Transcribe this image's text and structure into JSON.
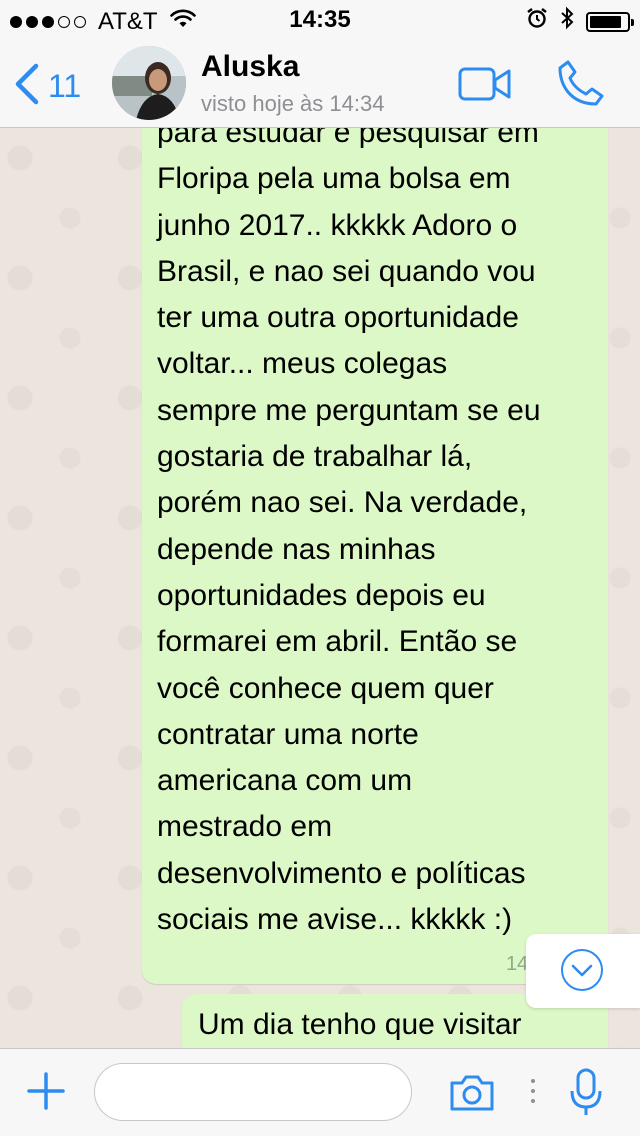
{
  "status_bar": {
    "carrier": "AT&T",
    "time": "14:35",
    "signal_bars_filled": 3,
    "signal_bars_total": 5,
    "battery_level": 0.9
  },
  "header": {
    "back_count": "11",
    "contact_name": "Aluska",
    "contact_status": "visto hoje às 14:34",
    "icons": [
      "chevron-left-icon",
      "video-camera-icon",
      "phone-icon"
    ]
  },
  "messages": [
    {
      "direction": "outgoing",
      "text": "para estudar e pesquisar em\nFloripa pela uma bolsa em\njunho 2017.. kkkkk Adoro o\nBrasil, e nao sei quando vou\nter uma outra oportunidade\nvoltar... meus colegas\nsempre me perguntam se eu\ngostaria de trabalhar lá,\nporém nao sei.  Na verdade,\ndepende nas minhas\noportunidades depois eu\nformarei em abril.  Então se\nvocê conhece quem quer\ncontratar uma norte\namericana com um\nmestrado em\ndesenvolvimento e políticas\nsociais me avise... kkkkk :)",
      "time": "14:03"
    },
    {
      "direction": "outgoing",
      "text": "Um dia tenho que visitar",
      "time": ""
    }
  ],
  "input_bar": {
    "placeholder": "",
    "icons": [
      "plus-icon",
      "camera-icon",
      "microphone-icon"
    ]
  },
  "colors": {
    "accent": "#2d8cf0",
    "bubble_outgoing": "#dcf8c6",
    "chat_background": "#ece5dd",
    "bar_background": "#f7f7f7"
  }
}
